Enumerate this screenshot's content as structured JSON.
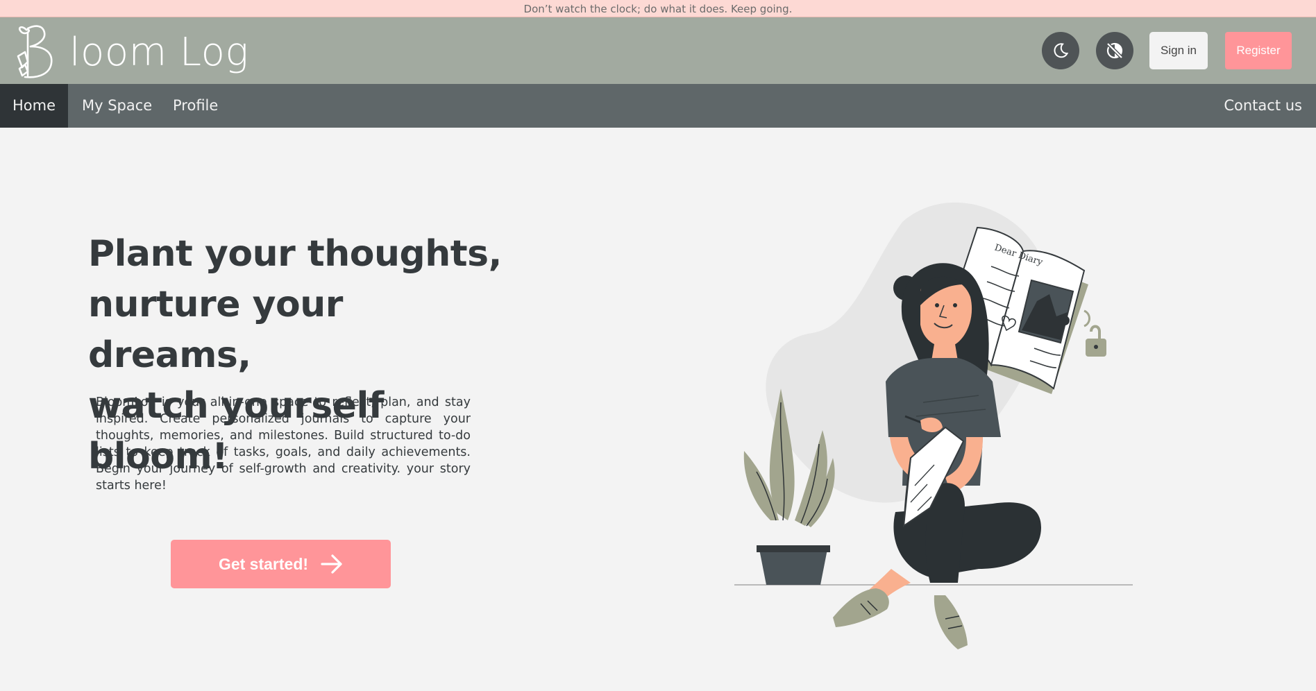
{
  "quote": "Don’t watch the clock; do what it does. Keep going.",
  "header": {
    "logo_text": "loom Log",
    "signin_label": "Sign in",
    "register_label": "Register",
    "theme_icon": "moon-icon",
    "contrast_icon": "eye-slash-icon"
  },
  "nav": {
    "items": [
      {
        "label": "Home",
        "active": true
      },
      {
        "label": "My Space"
      },
      {
        "label": "Profile"
      }
    ],
    "contact_label": "Contact us"
  },
  "hero": {
    "title_lines": [
      "Plant your thoughts,",
      "nurture your dreams,",
      "watch yourself bloom!"
    ],
    "description": "BloomLog is your all-in-one space to reflect, plan, and stay inspired. Create personalized journals to capture your thoughts, memories, and milestones. Build structured to-do lists to keep track of tasks, goals, and daily achievements. Begin your journey of self-growth and creativity. your story starts here!",
    "cta_label": "Get started!",
    "cta_icon": "arrow-right-icon",
    "diary_text": "Dear Diary"
  },
  "colors": {
    "quote_bg": "#fdd9d4",
    "header_bg": "#a2aaa0",
    "nav_bg": "#5f6769",
    "nav_active_bg": "#2f3437",
    "accent": "#ff9599",
    "page_bg": "#f3f3f3",
    "text_dark": "#353a3d"
  }
}
